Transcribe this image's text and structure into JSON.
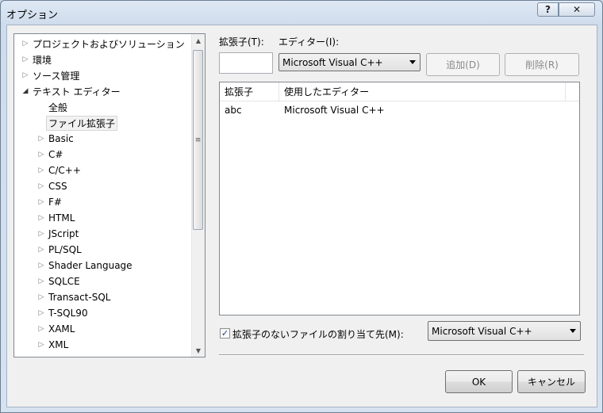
{
  "window": {
    "title": "オプション",
    "help_glyph": "?",
    "close_glyph": "✕"
  },
  "tree": {
    "items": [
      {
        "label": "プロジェクトおよびソリューション",
        "level": 0,
        "expander": "collapsed"
      },
      {
        "label": "環境",
        "level": 0,
        "expander": "collapsed"
      },
      {
        "label": "ソース管理",
        "level": 0,
        "expander": "collapsed"
      },
      {
        "label": "テキスト エディター",
        "level": 0,
        "expander": "expanded"
      },
      {
        "label": "全般",
        "level": 1,
        "expander": "none"
      },
      {
        "label": "ファイル拡張子",
        "level": 1,
        "expander": "none",
        "selected": true
      },
      {
        "label": "Basic",
        "level": 1,
        "expander": "collapsed"
      },
      {
        "label": "C#",
        "level": 1,
        "expander": "collapsed"
      },
      {
        "label": "C/C++",
        "level": 1,
        "expander": "collapsed"
      },
      {
        "label": "CSS",
        "level": 1,
        "expander": "collapsed"
      },
      {
        "label": "F#",
        "level": 1,
        "expander": "collapsed"
      },
      {
        "label": "HTML",
        "level": 1,
        "expander": "collapsed"
      },
      {
        "label": "JScript",
        "level": 1,
        "expander": "collapsed"
      },
      {
        "label": "PL/SQL",
        "level": 1,
        "expander": "collapsed"
      },
      {
        "label": "Shader Language",
        "level": 1,
        "expander": "collapsed"
      },
      {
        "label": "SQLCE",
        "level": 1,
        "expander": "collapsed"
      },
      {
        "label": "Transact-SQL",
        "level": 1,
        "expander": "collapsed"
      },
      {
        "label": "T-SQL90",
        "level": 1,
        "expander": "collapsed"
      },
      {
        "label": "XAML",
        "level": 1,
        "expander": "collapsed"
      },
      {
        "label": "XML",
        "level": 1,
        "expander": "collapsed"
      }
    ]
  },
  "extension": {
    "label": "拡張子(T):",
    "value": ""
  },
  "editor": {
    "label": "エディター(I):",
    "value": "Microsoft Visual C++"
  },
  "buttons": {
    "add": "追加(D)",
    "remove": "削除(R)",
    "ok": "OK",
    "cancel": "キャンセル"
  },
  "table": {
    "columns": [
      "拡張子",
      "使用したエディター"
    ],
    "rows": [
      {
        "extension": "abc",
        "editor": "Microsoft Visual C++"
      }
    ]
  },
  "mapping": {
    "checkbox_label": "拡張子のないファイルの割り当て先(M):",
    "checked": true,
    "check_glyph": "✓",
    "value": "Microsoft Visual C++"
  },
  "icons": {
    "collapsed": "▷",
    "expanded": "◢",
    "scroll_up": "▲",
    "scroll_down": "▼",
    "grip": "≡"
  }
}
